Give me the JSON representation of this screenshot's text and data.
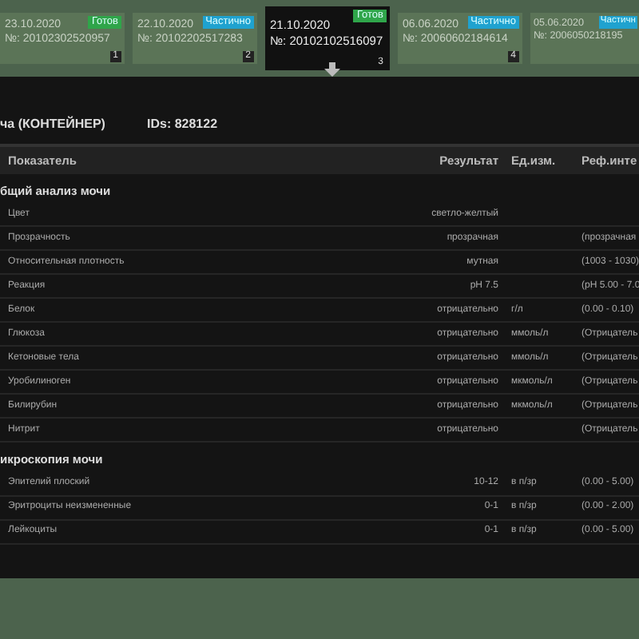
{
  "cards": [
    {
      "date": "23.10.2020",
      "number": "№: 20102302520957",
      "status": "Готов",
      "color": "#2fa54a",
      "index": "1",
      "selected": false
    },
    {
      "date": "22.10.2020",
      "number": "№: 20102202517283",
      "status": "Частично",
      "color": "#1fa2cf",
      "index": "2",
      "selected": false
    },
    {
      "date": "21.10.2020",
      "number": "№: 20102102516097",
      "status": "Готов",
      "color": "#2fa54a",
      "index": "3",
      "selected": true
    },
    {
      "date": "06.06.2020",
      "number": "№: 20060602184614",
      "status": "Частично",
      "color": "#1fa2cf",
      "index": "4",
      "selected": false
    },
    {
      "date": "05.06.2020",
      "number": "№: 2006050218195",
      "status": "Частичн",
      "color": "#1fa2cf",
      "selected": false
    }
  ],
  "sample": {
    "material": "ча (КОНТЕЙНЕР)",
    "ids": "IDs: 828122"
  },
  "table": {
    "columns": [
      "Показатель",
      "Результат",
      "Ед.изм.",
      "Реф.инте"
    ],
    "sections": [
      {
        "title": "бщий анализ мочи",
        "rows": [
          [
            "Цвет",
            "светло-желтый",
            "",
            ""
          ],
          [
            "Прозрачность",
            "прозрачная",
            "",
            "(прозрачная"
          ],
          [
            "Относительная плотность",
            "мутная",
            "",
            "(1003 - 1030)"
          ],
          [
            "Реакция",
            "pH 7.5",
            "",
            "(pH 5.00 - 7.0"
          ],
          [
            "Белок",
            "отрицательно",
            "г/л",
            "(0.00 - 0.10)"
          ],
          [
            "Глюкоза",
            "отрицательно",
            "ммоль/л",
            "(Отрицатель"
          ],
          [
            "Кетоновые тела",
            "отрицательно",
            "ммоль/л",
            "(Отрицатель"
          ],
          [
            "Уробилиноген",
            "отрицательно",
            "мкмоль/л",
            "(Отрицатель"
          ],
          [
            "Билирубин",
            "отрицательно",
            "мкмоль/л",
            "(Отрицатель"
          ],
          [
            "Нитрит",
            "отрицательно",
            "",
            "(Отрицатель"
          ]
        ]
      },
      {
        "title": "икроскопия мочи",
        "rows": [
          [
            "Эпителий плоский",
            "10-12",
            "в п/зр",
            "(0.00 - 5.00)"
          ],
          [
            "Эритроциты неизмененные",
            "0-1",
            "в п/зр",
            "(0.00 - 2.00)"
          ],
          [
            "Лейкоциты",
            "0-1",
            "в п/зр",
            "(0.00 - 5.00)"
          ]
        ]
      }
    ]
  }
}
